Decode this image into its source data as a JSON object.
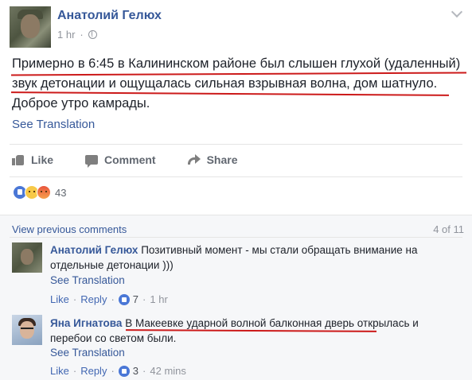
{
  "post": {
    "author": "Анатолий Гелюх",
    "time": "1 hr",
    "text_line1": "Примерно в 6:45 в Калининском районе был слышен глухой (удаленный)",
    "text_line2": "звук детонации и ощущалась сильная взрывная волна, дом шатнуло.",
    "text_line3": "Доброе утро камрады.",
    "see_translation": "See Translation"
  },
  "actions": {
    "like": "Like",
    "comment": "Comment",
    "share": "Share"
  },
  "reactions": {
    "count": "43",
    "types": [
      "like-icon",
      "sad-icon",
      "angry-icon"
    ]
  },
  "comments": {
    "view_previous": "View previous comments",
    "pager": "4 of 11",
    "items": [
      {
        "author": "Анатолий Гелюх",
        "text_part1": "Позитивный момент - мы стали обращать внимание на",
        "text_part2": "отдельные детонации )))",
        "see_translation": "See Translation",
        "like": "Like",
        "reply": "Reply",
        "likes": "7",
        "time": "1 hr"
      },
      {
        "author": "Яна Игнатова",
        "text_part1": "В Макеевке ударной волной балконная дверь",
        "text_part1b": "открылась и",
        "text_part2": "перебои со светом были.",
        "see_translation": "See Translation",
        "like": "Like",
        "reply": "Reply",
        "likes": "3",
        "time": "42 mins"
      }
    ]
  },
  "colors": {
    "link": "#365899",
    "underline": "#cc1a1a",
    "meta": "#90949c"
  }
}
